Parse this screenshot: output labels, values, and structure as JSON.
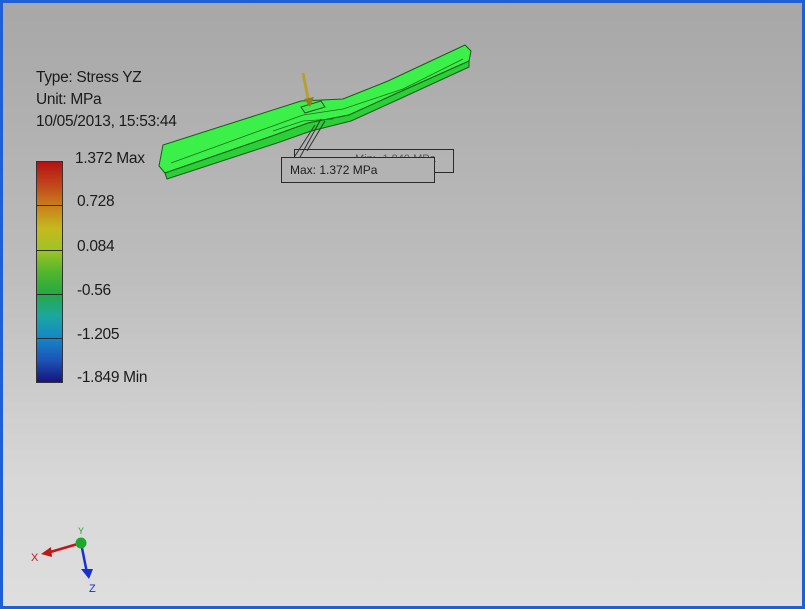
{
  "result_info": {
    "type_line": "Type: Stress YZ",
    "unit_line": "Unit: MPa",
    "date_line": "10/05/2013, 15:53:44"
  },
  "legend": {
    "max_label": "1.372 Max",
    "labels": [
      "0.728",
      "0.084",
      "-0.56",
      "-1.205"
    ],
    "min_label": "-1.849 Min",
    "colors": [
      "#b41212",
      "#c8801c",
      "#c6b81e",
      "#52b62c",
      "#1ca7a0",
      "#1487c8",
      "#16147c"
    ]
  },
  "probe": {
    "front_label": "Max: 1.372 MPa",
    "back_label": "Min: -1.849 MPa"
  },
  "model": {
    "color": "#3cf04a",
    "edge_color": "#1a5a1a"
  },
  "triad": {
    "x_label": "X",
    "y_label": "Y",
    "z_label": "Z",
    "x_color": "#c01818",
    "y_color": "#1ea82a",
    "z_color": "#1a2fd0"
  },
  "frame": {
    "border_color": "#1e5fd6"
  }
}
